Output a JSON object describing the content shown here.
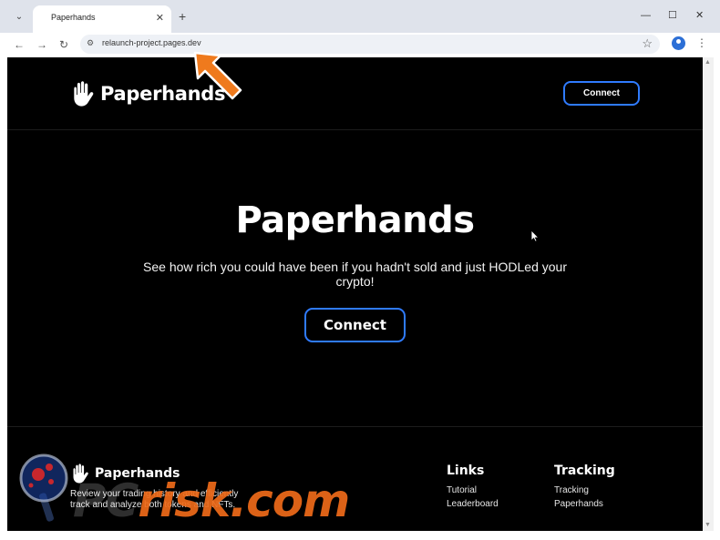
{
  "browser": {
    "tab_title": "Paperhands",
    "tab_close": "✕",
    "new_tab": "+",
    "url": "relaunch-project.pages.dev",
    "win_minimize": "—",
    "win_maximize": "☐",
    "win_close": "✕",
    "tab_menu": "⌄"
  },
  "site": {
    "logo_text": "Paperhands",
    "header_connect": "Connect",
    "hero": {
      "title": "Paperhands",
      "subtitle": "See how rich you could have been if you hadn't sold and just HODLed your crypto!",
      "connect": "Connect"
    },
    "footer": {
      "logo_text": "Paperhands",
      "description": "Review your trading history and efficiently track and analyze both tokens and NFTs.",
      "columns": [
        {
          "title": "Links",
          "items": [
            "Tutorial",
            "Leaderboard"
          ]
        },
        {
          "title": "Tracking",
          "items": [
            "Tracking",
            "Paperhands"
          ]
        }
      ]
    }
  },
  "watermark": {
    "text_pre": "PC",
    "text_post": "risk.com"
  },
  "colors": {
    "accent_blue": "#2f7bff",
    "watermark_orange": "#ef6a19",
    "page_bg": "#000000"
  },
  "icons": {
    "logo": "hand-icon",
    "arrow": "arrow-icon",
    "star": "star-icon",
    "profile": "profile-icon"
  }
}
